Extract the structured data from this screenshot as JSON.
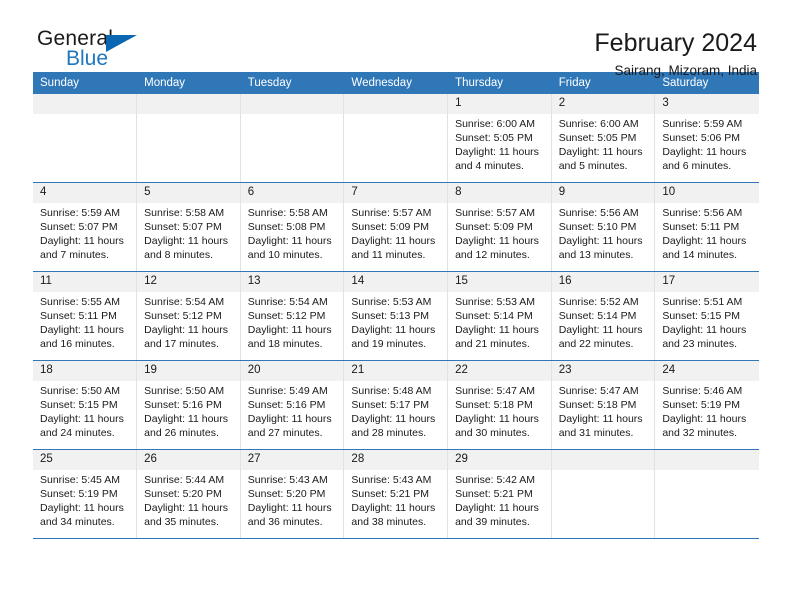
{
  "logo": {
    "word_top": "General",
    "word_bottom": "Blue",
    "triangle_color": "#0a66b0",
    "blue_text_color": "#1f77bd"
  },
  "header": {
    "title": "February 2024",
    "subtitle": "Sairang, Mizoram, India"
  },
  "theme": {
    "header_blue": "#3077b8",
    "daynum_gray": "#f1f1f1",
    "grid_line": "#e2e2e2"
  },
  "weekdays": [
    "Sunday",
    "Monday",
    "Tuesday",
    "Wednesday",
    "Thursday",
    "Friday",
    "Saturday"
  ],
  "labels": {
    "sunrise_prefix": "Sunrise: ",
    "sunset_prefix": "Sunset: ",
    "daylight_prefix": "Daylight: "
  },
  "weeks": [
    [
      {
        "day": "",
        "sunrise": "",
        "sunset": "",
        "daylight_line1": "",
        "daylight_line2": ""
      },
      {
        "day": "",
        "sunrise": "",
        "sunset": "",
        "daylight_line1": "",
        "daylight_line2": ""
      },
      {
        "day": "",
        "sunrise": "",
        "sunset": "",
        "daylight_line1": "",
        "daylight_line2": ""
      },
      {
        "day": "",
        "sunrise": "",
        "sunset": "",
        "daylight_line1": "",
        "daylight_line2": ""
      },
      {
        "day": "1",
        "sunrise": "Sunrise: 6:00 AM",
        "sunset": "Sunset: 5:05 PM",
        "daylight_line1": "Daylight: 11 hours",
        "daylight_line2": "and 4 minutes."
      },
      {
        "day": "2",
        "sunrise": "Sunrise: 6:00 AM",
        "sunset": "Sunset: 5:05 PM",
        "daylight_line1": "Daylight: 11 hours",
        "daylight_line2": "and 5 minutes."
      },
      {
        "day": "3",
        "sunrise": "Sunrise: 5:59 AM",
        "sunset": "Sunset: 5:06 PM",
        "daylight_line1": "Daylight: 11 hours",
        "daylight_line2": "and 6 minutes."
      }
    ],
    [
      {
        "day": "4",
        "sunrise": "Sunrise: 5:59 AM",
        "sunset": "Sunset: 5:07 PM",
        "daylight_line1": "Daylight: 11 hours",
        "daylight_line2": "and 7 minutes."
      },
      {
        "day": "5",
        "sunrise": "Sunrise: 5:58 AM",
        "sunset": "Sunset: 5:07 PM",
        "daylight_line1": "Daylight: 11 hours",
        "daylight_line2": "and 8 minutes."
      },
      {
        "day": "6",
        "sunrise": "Sunrise: 5:58 AM",
        "sunset": "Sunset: 5:08 PM",
        "daylight_line1": "Daylight: 11 hours",
        "daylight_line2": "and 10 minutes."
      },
      {
        "day": "7",
        "sunrise": "Sunrise: 5:57 AM",
        "sunset": "Sunset: 5:09 PM",
        "daylight_line1": "Daylight: 11 hours",
        "daylight_line2": "and 11 minutes."
      },
      {
        "day": "8",
        "sunrise": "Sunrise: 5:57 AM",
        "sunset": "Sunset: 5:09 PM",
        "daylight_line1": "Daylight: 11 hours",
        "daylight_line2": "and 12 minutes."
      },
      {
        "day": "9",
        "sunrise": "Sunrise: 5:56 AM",
        "sunset": "Sunset: 5:10 PM",
        "daylight_line1": "Daylight: 11 hours",
        "daylight_line2": "and 13 minutes."
      },
      {
        "day": "10",
        "sunrise": "Sunrise: 5:56 AM",
        "sunset": "Sunset: 5:11 PM",
        "daylight_line1": "Daylight: 11 hours",
        "daylight_line2": "and 14 minutes."
      }
    ],
    [
      {
        "day": "11",
        "sunrise": "Sunrise: 5:55 AM",
        "sunset": "Sunset: 5:11 PM",
        "daylight_line1": "Daylight: 11 hours",
        "daylight_line2": "and 16 minutes."
      },
      {
        "day": "12",
        "sunrise": "Sunrise: 5:54 AM",
        "sunset": "Sunset: 5:12 PM",
        "daylight_line1": "Daylight: 11 hours",
        "daylight_line2": "and 17 minutes."
      },
      {
        "day": "13",
        "sunrise": "Sunrise: 5:54 AM",
        "sunset": "Sunset: 5:12 PM",
        "daylight_line1": "Daylight: 11 hours",
        "daylight_line2": "and 18 minutes."
      },
      {
        "day": "14",
        "sunrise": "Sunrise: 5:53 AM",
        "sunset": "Sunset: 5:13 PM",
        "daylight_line1": "Daylight: 11 hours",
        "daylight_line2": "and 19 minutes."
      },
      {
        "day": "15",
        "sunrise": "Sunrise: 5:53 AM",
        "sunset": "Sunset: 5:14 PM",
        "daylight_line1": "Daylight: 11 hours",
        "daylight_line2": "and 21 minutes."
      },
      {
        "day": "16",
        "sunrise": "Sunrise: 5:52 AM",
        "sunset": "Sunset: 5:14 PM",
        "daylight_line1": "Daylight: 11 hours",
        "daylight_line2": "and 22 minutes."
      },
      {
        "day": "17",
        "sunrise": "Sunrise: 5:51 AM",
        "sunset": "Sunset: 5:15 PM",
        "daylight_line1": "Daylight: 11 hours",
        "daylight_line2": "and 23 minutes."
      }
    ],
    [
      {
        "day": "18",
        "sunrise": "Sunrise: 5:50 AM",
        "sunset": "Sunset: 5:15 PM",
        "daylight_line1": "Daylight: 11 hours",
        "daylight_line2": "and 24 minutes."
      },
      {
        "day": "19",
        "sunrise": "Sunrise: 5:50 AM",
        "sunset": "Sunset: 5:16 PM",
        "daylight_line1": "Daylight: 11 hours",
        "daylight_line2": "and 26 minutes."
      },
      {
        "day": "20",
        "sunrise": "Sunrise: 5:49 AM",
        "sunset": "Sunset: 5:16 PM",
        "daylight_line1": "Daylight: 11 hours",
        "daylight_line2": "and 27 minutes."
      },
      {
        "day": "21",
        "sunrise": "Sunrise: 5:48 AM",
        "sunset": "Sunset: 5:17 PM",
        "daylight_line1": "Daylight: 11 hours",
        "daylight_line2": "and 28 minutes."
      },
      {
        "day": "22",
        "sunrise": "Sunrise: 5:47 AM",
        "sunset": "Sunset: 5:18 PM",
        "daylight_line1": "Daylight: 11 hours",
        "daylight_line2": "and 30 minutes."
      },
      {
        "day": "23",
        "sunrise": "Sunrise: 5:47 AM",
        "sunset": "Sunset: 5:18 PM",
        "daylight_line1": "Daylight: 11 hours",
        "daylight_line2": "and 31 minutes."
      },
      {
        "day": "24",
        "sunrise": "Sunrise: 5:46 AM",
        "sunset": "Sunset: 5:19 PM",
        "daylight_line1": "Daylight: 11 hours",
        "daylight_line2": "and 32 minutes."
      }
    ],
    [
      {
        "day": "25",
        "sunrise": "Sunrise: 5:45 AM",
        "sunset": "Sunset: 5:19 PM",
        "daylight_line1": "Daylight: 11 hours",
        "daylight_line2": "and 34 minutes."
      },
      {
        "day": "26",
        "sunrise": "Sunrise: 5:44 AM",
        "sunset": "Sunset: 5:20 PM",
        "daylight_line1": "Daylight: 11 hours",
        "daylight_line2": "and 35 minutes."
      },
      {
        "day": "27",
        "sunrise": "Sunrise: 5:43 AM",
        "sunset": "Sunset: 5:20 PM",
        "daylight_line1": "Daylight: 11 hours",
        "daylight_line2": "and 36 minutes."
      },
      {
        "day": "28",
        "sunrise": "Sunrise: 5:43 AM",
        "sunset": "Sunset: 5:21 PM",
        "daylight_line1": "Daylight: 11 hours",
        "daylight_line2": "and 38 minutes."
      },
      {
        "day": "29",
        "sunrise": "Sunrise: 5:42 AM",
        "sunset": "Sunset: 5:21 PM",
        "daylight_line1": "Daylight: 11 hours",
        "daylight_line2": "and 39 minutes."
      },
      {
        "day": "",
        "sunrise": "",
        "sunset": "",
        "daylight_line1": "",
        "daylight_line2": ""
      },
      {
        "day": "",
        "sunrise": "",
        "sunset": "",
        "daylight_line1": "",
        "daylight_line2": ""
      }
    ]
  ]
}
